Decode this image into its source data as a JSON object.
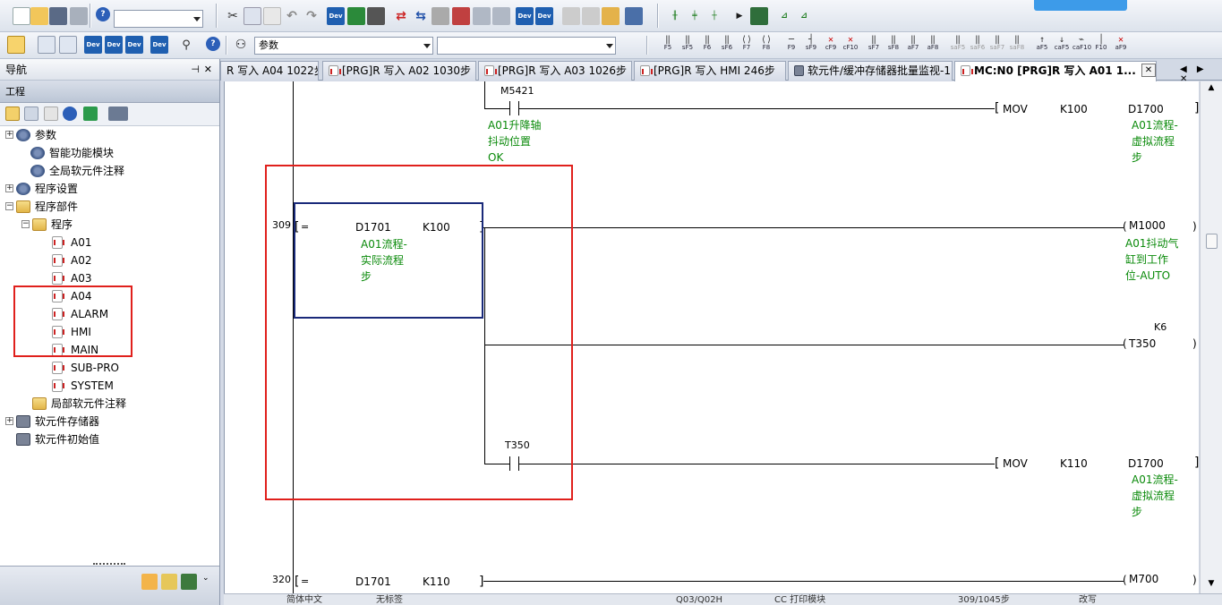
{
  "toolbar": {
    "combo1_value": "",
    "combo2_value": "参数",
    "combo3_value": "",
    "fkeys": [
      "F5",
      "sF5",
      "F6",
      "sF6",
      "F7",
      "F8",
      "F9",
      "sF9",
      "cF9",
      "cF10",
      "sF7",
      "sF8",
      "aF7",
      "aF8",
      "saF5",
      "saF6",
      "saF7",
      "saF8",
      "aF5",
      "caF5",
      "caF10",
      "F10",
      "aF9"
    ]
  },
  "nav": {
    "title": "导航",
    "pin": "⊣",
    "close": "✕",
    "project_label": "工程",
    "tree": [
      {
        "label": "参数",
        "expander": "+"
      },
      {
        "label": "智能功能模块",
        "expander": ""
      },
      {
        "label": "全局软元件注释",
        "expander": ""
      },
      {
        "label": "程序设置",
        "expander": "+"
      },
      {
        "label": "程序部件",
        "expander": "−"
      },
      {
        "label": "程序",
        "expander": "−"
      },
      {
        "label": "A01",
        "expander": ""
      },
      {
        "label": "A02",
        "expander": ""
      },
      {
        "label": "A03",
        "expander": ""
      },
      {
        "label": "A04",
        "expander": ""
      },
      {
        "label": "ALARM",
        "expander": ""
      },
      {
        "label": "HMI",
        "expander": ""
      },
      {
        "label": "MAIN",
        "expander": ""
      },
      {
        "label": "SUB-PRO",
        "expander": ""
      },
      {
        "label": "SYSTEM",
        "expander": ""
      },
      {
        "label": "局部软元件注释",
        "expander": ""
      },
      {
        "label": "软元件存储器",
        "expander": "+"
      },
      {
        "label": "软元件初始值",
        "expander": ""
      }
    ]
  },
  "tabs": [
    "R 写入 A04 1022步",
    "[PRG]R 写入 A02 1030步",
    "[PRG]R 写入 A03 1026步",
    "[PRG]R 写入 HMI 246步",
    "软元件/缓冲存储器批量监视-1",
    "MC:N0 [PRG]R 写入 A01 1..."
  ],
  "tab_close": "✕",
  "tab_arrows": "◀ ▶ ✕",
  "scroll": {
    "up": "▲",
    "down": "▼"
  },
  "ladder": {
    "r0": {
      "contact": "M5421",
      "contact_comment": [
        "A01升降轴",
        "抖动位置",
        "OK"
      ],
      "instr": "MOV",
      "src": "K100",
      "dst": "D1700",
      "dst_comment": [
        "A01流程-",
        "虚拟流程",
        "步"
      ]
    },
    "r1": {
      "step": "309",
      "op": "=",
      "s1": "D1701",
      "s2": "K100",
      "s1_comment": [
        "A01流程-",
        "实际流程",
        "步"
      ],
      "coil": "M1000",
      "coil_comment": [
        "A01抖动气",
        "缸到工作",
        "位-AUTO"
      ]
    },
    "r2": {
      "timer": "T350",
      "preset": "K6"
    },
    "r3": {
      "contact": "T350",
      "instr": "MOV",
      "src": "K110",
      "dst": "D1700",
      "dst_comment": [
        "A01流程-",
        "虚拟流程",
        "步"
      ]
    },
    "r4": {
      "step": "320",
      "op": "=",
      "s1": "D1701",
      "s2": "K110",
      "coil": "M700"
    }
  },
  "status": {
    "s1": "简体中文",
    "s2": "无标签",
    "s3": "Q03/Q02H",
    "s4": "CC 打印模块",
    "s5": "309/1045步",
    "s6": "改写"
  }
}
